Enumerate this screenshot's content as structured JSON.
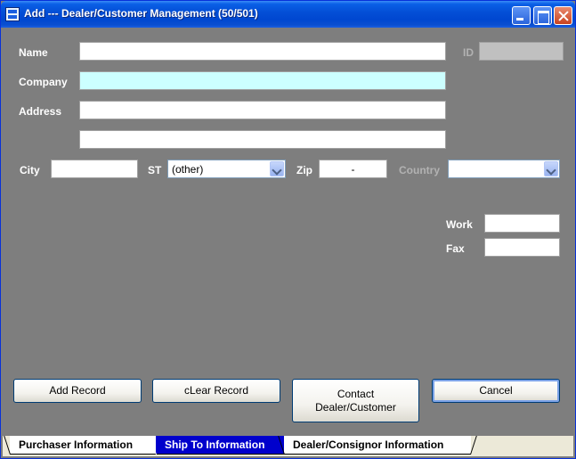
{
  "window": {
    "title": "Add --- Dealer/Customer Management (50/501)"
  },
  "form": {
    "name": {
      "label": "Name",
      "value": ""
    },
    "id": {
      "label": "ID",
      "value": ""
    },
    "company": {
      "label": "Company",
      "value": ""
    },
    "address": {
      "label": "Address",
      "line1": "",
      "line2": ""
    },
    "city": {
      "label": "City",
      "value": ""
    },
    "state": {
      "label": "ST",
      "value": "(other)"
    },
    "zip": {
      "label": "Zip",
      "value": "-"
    },
    "country": {
      "label": "Country",
      "value": ""
    },
    "work": {
      "label": "Work",
      "value": ""
    },
    "fax": {
      "label": "Fax",
      "value": ""
    }
  },
  "buttons": {
    "add_record": "Add Record",
    "clear_record": "cLear Record",
    "contact_line1": "Contact",
    "contact_line2": "Dealer/Customer",
    "cancel": "Cancel"
  },
  "tabs": [
    {
      "label": "Purchaser Information",
      "active": false
    },
    {
      "label": "Ship To Information",
      "active": true
    },
    {
      "label": "Dealer/Consignor Information",
      "active": false
    }
  ],
  "colors": {
    "background": "#7e7e7e",
    "company_field": "#ccffff",
    "active_tab": "#0000cc",
    "titlebar": "#0450d7"
  },
  "icons": {
    "app": "app-icon",
    "minimize": "minimize-icon",
    "maximize": "maximize-icon",
    "close": "close-icon",
    "dropdown": "chevron-down-icon"
  }
}
